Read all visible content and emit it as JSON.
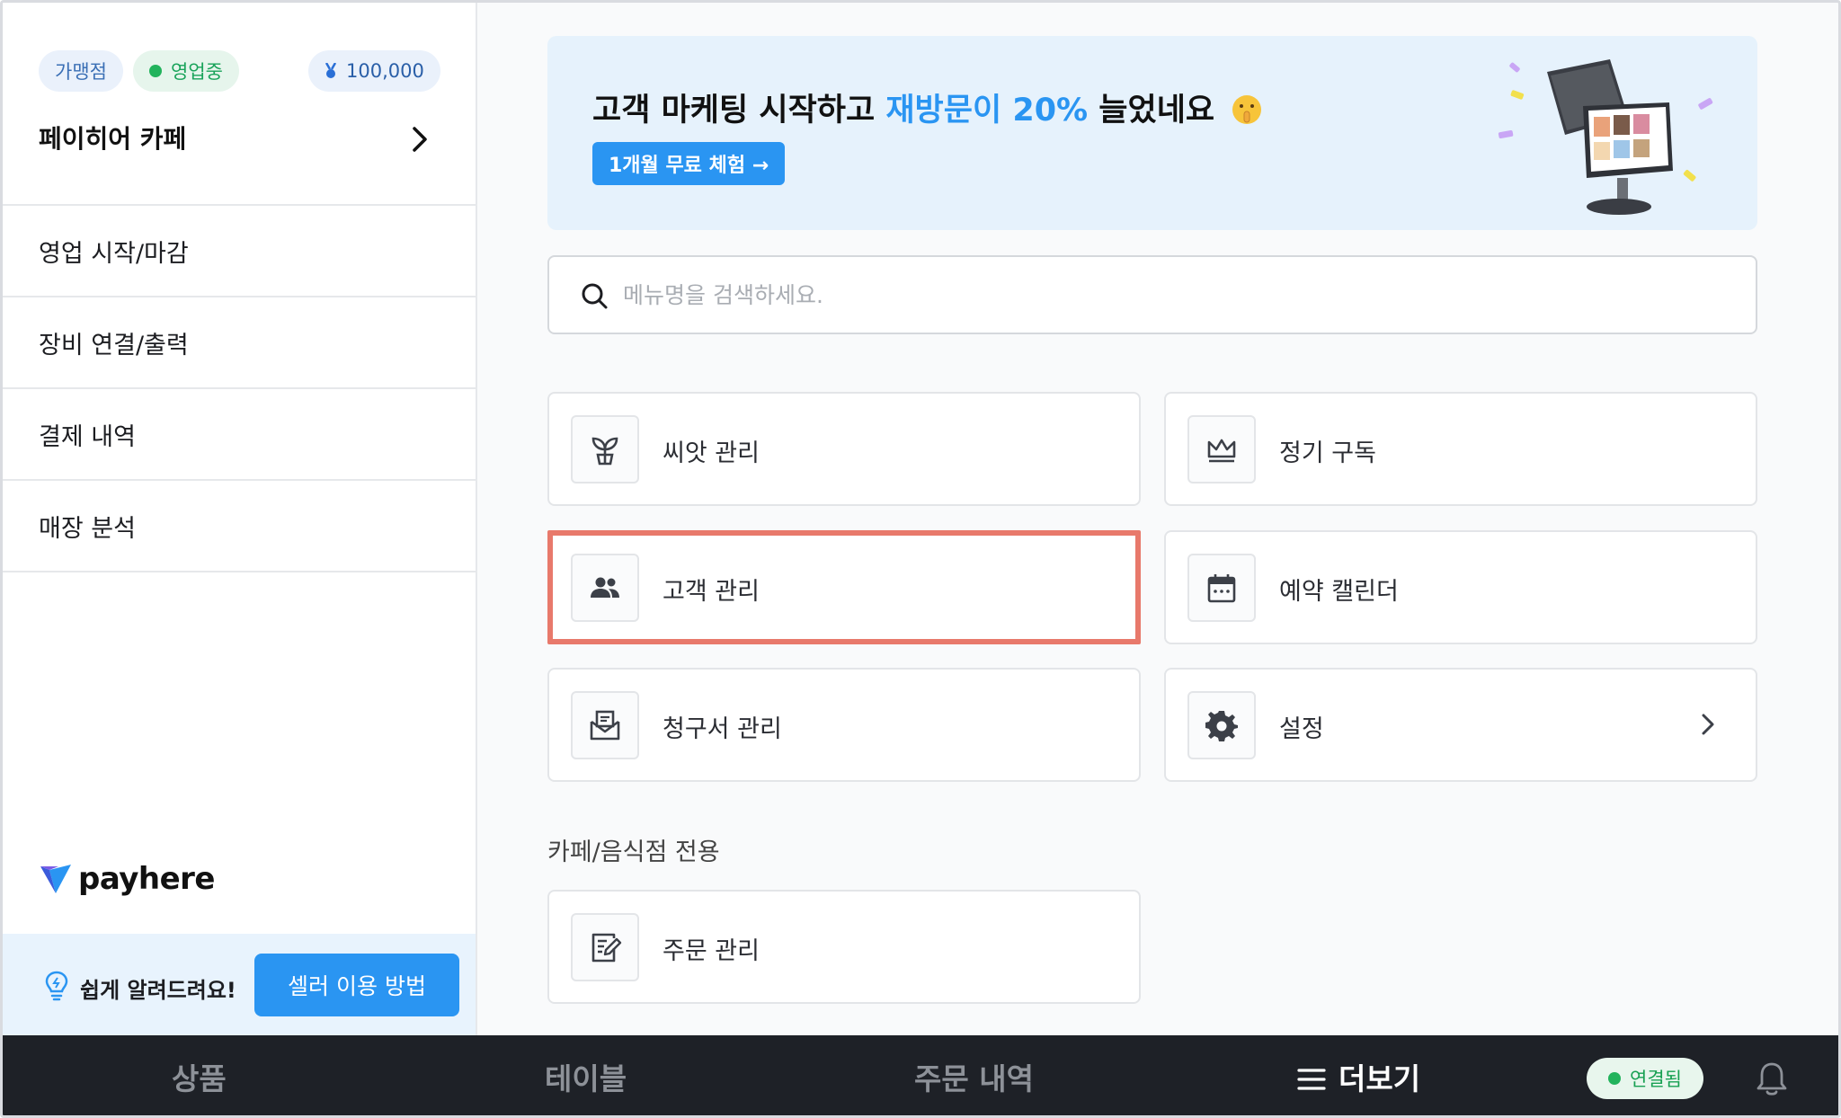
{
  "sidebar": {
    "badges": {
      "franchise": "가맹점",
      "status": "영업중",
      "points": "100,000"
    },
    "store_name": "페이히어 카페",
    "nav": [
      {
        "label": "영업 시작/마감"
      },
      {
        "label": "장비 연결/출력"
      },
      {
        "label": "결제 내역"
      },
      {
        "label": "매장 분석"
      }
    ],
    "logo_text": "payhere",
    "help": {
      "text": "쉽게 알려드려요!",
      "button": "셀러 이용 방법"
    }
  },
  "banner": {
    "title_prefix": "고객 마케팅 시작하고 ",
    "title_highlight": "재방문이 20%",
    "title_suffix": " 늘었네요",
    "button": "1개월 무료 체험 →"
  },
  "search": {
    "placeholder": "메뉴명을 검색하세요."
  },
  "menu": [
    {
      "label": "씨앗 관리",
      "icon": "sprout-icon"
    },
    {
      "label": "정기 구독",
      "icon": "crown-icon"
    },
    {
      "label": "고객 관리",
      "icon": "people-icon"
    },
    {
      "label": "예약 캘린더",
      "icon": "calendar-icon"
    },
    {
      "label": "청구서 관리",
      "icon": "invoice-mail-icon"
    },
    {
      "label": "설정",
      "icon": "gear-icon"
    }
  ],
  "cafe_section": {
    "title": "카페/음식점 전용",
    "items": [
      {
        "label": "주문 관리",
        "icon": "order-edit-icon"
      }
    ]
  },
  "bottom_bar": {
    "tabs": [
      "상품",
      "테이블",
      "주문 내역",
      "더보기"
    ],
    "active_tab": "더보기",
    "connection": "연결됨"
  },
  "colors": {
    "accent": "#2a95f2",
    "status_green": "#22b35c",
    "highlight_border": "#e8796b",
    "bottom_bar": "#1e2127"
  }
}
